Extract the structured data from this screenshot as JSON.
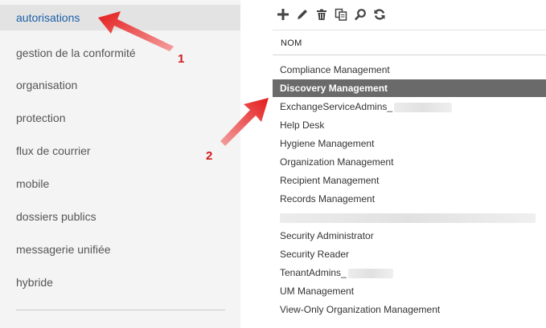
{
  "sidebar": {
    "items": [
      {
        "label": "autorisations",
        "active": true
      },
      {
        "label": "gestion de la conformité"
      },
      {
        "label": "organisation"
      },
      {
        "label": "protection"
      },
      {
        "label": "flux de courrier"
      },
      {
        "label": "mobile"
      },
      {
        "label": "dossiers publics"
      },
      {
        "label": "messagerie unifiée"
      },
      {
        "label": "hybride"
      }
    ]
  },
  "toolbar": {
    "buttons": [
      {
        "icon": "plus-icon"
      },
      {
        "icon": "pencil-icon"
      },
      {
        "icon": "trash-icon"
      },
      {
        "icon": "copy-icon"
      },
      {
        "icon": "search-icon"
      },
      {
        "icon": "refresh-icon"
      }
    ]
  },
  "table": {
    "column_header": "NOM",
    "rows": [
      {
        "name": "Compliance Management"
      },
      {
        "name": "Discovery Management",
        "selected": true
      },
      {
        "name": "ExchangeServiceAdmins_"
      },
      {
        "name": "Help Desk"
      },
      {
        "name": "Hygiene Management"
      },
      {
        "name": "Organization Management"
      },
      {
        "name": "Recipient Management"
      },
      {
        "name": "Records Management"
      },
      {
        "name": ""
      },
      {
        "name": "Security Administrator"
      },
      {
        "name": "Security Reader"
      },
      {
        "name": "TenantAdmins_"
      },
      {
        "name": "UM Management"
      },
      {
        "name": "View-Only Organization Management"
      }
    ]
  },
  "annotations": {
    "marker_1": "1",
    "marker_2": "2",
    "color": "#e41b1b"
  },
  "colors": {
    "active_nav_text": "#1b5fa8",
    "selected_row_bg": "#6a6a6a",
    "sidebar_bg": "#f4f4f4"
  }
}
